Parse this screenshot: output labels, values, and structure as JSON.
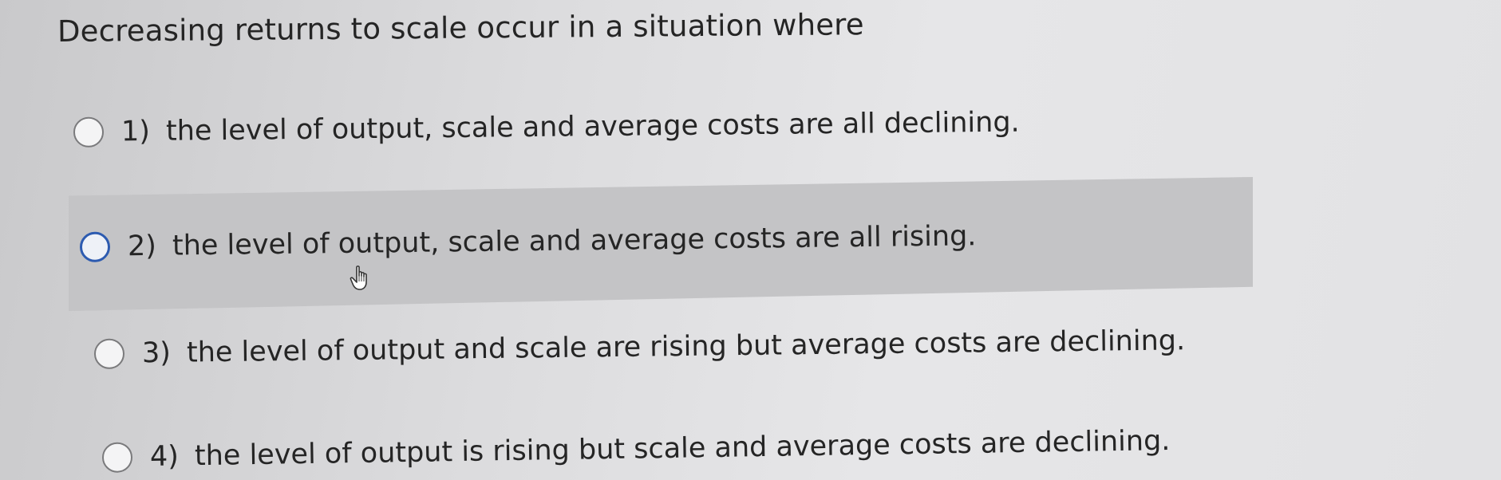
{
  "question": {
    "text": "Decreasing returns to scale occur in a situation where"
  },
  "options": [
    {
      "number": "1)",
      "text": "the level of output, scale and average costs are all declining."
    },
    {
      "number": "2)",
      "text": "the level of output, scale and average costs are all rising."
    },
    {
      "number": "3)",
      "text": "the level of output and scale are rising but average costs are declining."
    },
    {
      "number": "4)",
      "text": "the level of output is rising but scale and average costs are declining."
    }
  ],
  "hovered_option": 2,
  "colors": {
    "selected_radio": "#2d5bb0",
    "hover_row": "#c4c4c6",
    "background": "#dcdcde"
  },
  "icons": {
    "cursor": "hand-pointer-icon"
  }
}
